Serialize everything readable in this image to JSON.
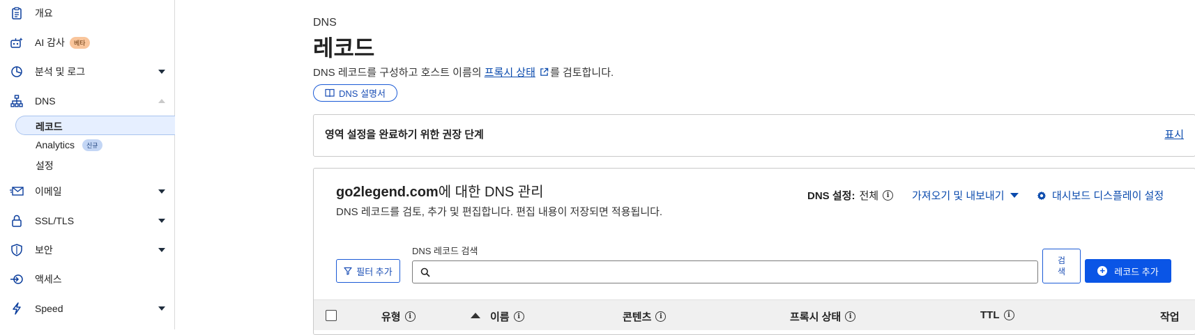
{
  "sidebar": {
    "items": [
      {
        "label": "개요",
        "icon": "clipboard-icon"
      },
      {
        "label": "AI 감사",
        "icon": "robot-icon",
        "badge": "베타"
      },
      {
        "label": "분석 및 로그",
        "icon": "pie-chart-icon"
      },
      {
        "label": "DNS",
        "icon": "network-icon"
      },
      {
        "label": "이메일",
        "icon": "envelope-icon"
      },
      {
        "label": "SSL/TLS",
        "icon": "lock-icon"
      },
      {
        "label": "보안",
        "icon": "shield-icon"
      },
      {
        "label": "액세스",
        "icon": "access-icon"
      },
      {
        "label": "Speed",
        "icon": "bolt-icon"
      }
    ],
    "dns_sub": [
      {
        "label": "레코드"
      },
      {
        "label": "Analytics",
        "badge": "신규"
      },
      {
        "label": "설정"
      }
    ]
  },
  "header": {
    "eyebrow": "DNS",
    "title": "레코드",
    "desc_prefix": "DNS 레코드를 구성하고 호스트 이름의",
    "desc_link": "프록시 상태",
    "desc_suffix": "를 검토합니다.",
    "docs_button": "DNS 설명서"
  },
  "setup_card": {
    "title": "영역 설정을 완료하기 위한 권장 단계",
    "show_link": "표시"
  },
  "management": {
    "domain": "go2legend.com",
    "domain_suffix": "에 대한 DNS 관리",
    "description": "DNS 레코드를 검토, 추가 및 편집합니다. 편집 내용이 저장되면 적용됩니다.",
    "dns_setting_label": "DNS 설정:",
    "dns_setting_value": "전체",
    "import_export": "가져오기 및 내보내기",
    "dashboard_settings": "대시보드 디스플레이 설정",
    "filter_button": "필터 추가",
    "search_label": "DNS 레코드 검색",
    "search_value": "",
    "search_placeholder": "",
    "search_button": "검색",
    "add_button": "레코드 추가"
  },
  "table": {
    "columns": [
      "유형",
      "이름",
      "콘텐츠",
      "프록시 상태",
      "TTL",
      "작업"
    ]
  },
  "colors": {
    "accent": "#0a55e6",
    "link": "#0a4aad",
    "beta_badge": "#f9c59b",
    "new_badge": "#c3d6f5"
  }
}
